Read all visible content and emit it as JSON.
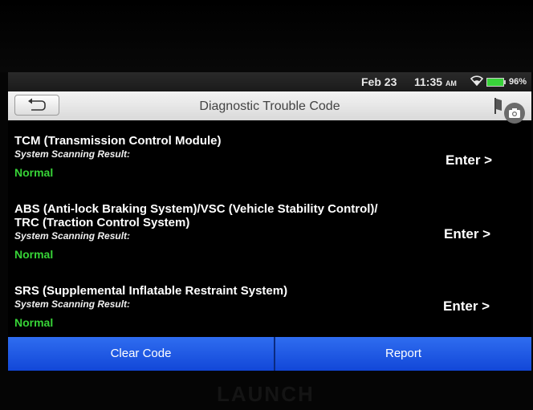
{
  "statusbar": {
    "date": "Feb 23",
    "time": "11:35",
    "ampm": "AM",
    "battery": "96%"
  },
  "header": {
    "title": "Diagnostic Trouble Code"
  },
  "systems": [
    {
      "name_lines": [
        "TCM (Transmission Control Module)"
      ],
      "label": "System Scanning Result:",
      "status": "Normal",
      "action": "Enter >"
    },
    {
      "name_lines": [
        "ABS (Anti-lock Braking System)/VSC (Vehicle Stability Control)/",
        "TRC (Traction Control System)"
      ],
      "label": "System Scanning Result:",
      "status": "Normal",
      "action": "Enter >"
    },
    {
      "name_lines": [
        "SRS (Supplemental Inflatable Restraint System)"
      ],
      "label": "System Scanning Result:",
      "status": "Normal",
      "action": "Enter >"
    }
  ],
  "buttons": {
    "clear_code": "Clear Code",
    "report": "Report"
  },
  "brand": "LAUNCH",
  "colors": {
    "status_normal": "#37d437",
    "button_blue": "#1f5ae6"
  }
}
